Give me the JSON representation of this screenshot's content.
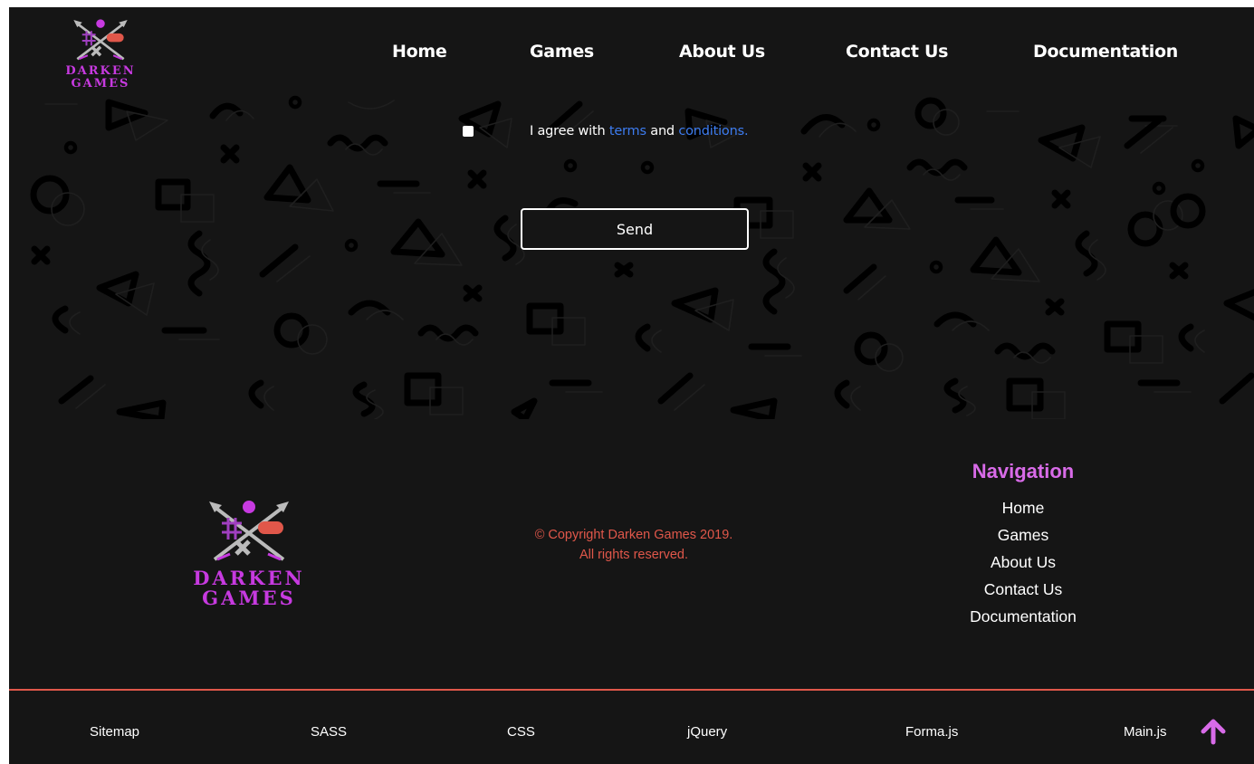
{
  "brand": {
    "line1": "DARKEN",
    "line2": "GAMES",
    "colors": {
      "accent": "#c73ae0",
      "red": "#e0574a",
      "link": "#3d7cf0",
      "background": "#151515"
    }
  },
  "header": {
    "nav": [
      "Home",
      "Games",
      "About Us",
      "Contact Us",
      "Documentation"
    ]
  },
  "form": {
    "agree_prefix": "I agree with ",
    "terms_link": "terms",
    "agree_middle": " and ",
    "conditions_link": "conditions.",
    "agree_checked": false,
    "send_label": "Send"
  },
  "footer": {
    "copyright_line1": "© Copyright Darken Games 2019.",
    "copyright_line2": "All rights reserved.",
    "nav_title": "Navigation",
    "nav_items": [
      "Home",
      "Games",
      "About Us",
      "Contact Us",
      "Documentation"
    ],
    "bottom_links": [
      "Sitemap",
      "SASS",
      "CSS",
      "jQuery",
      "Forma.js",
      "Main.js"
    ],
    "scroll_top_icon": "arrow-up-icon"
  }
}
